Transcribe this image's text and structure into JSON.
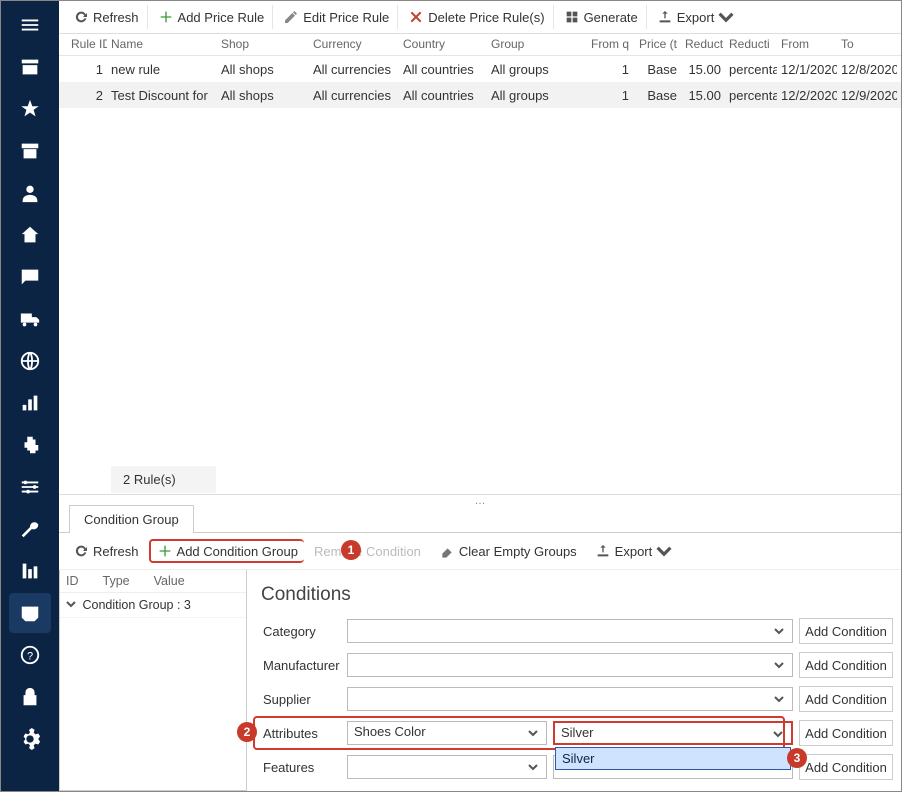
{
  "sidebar": {
    "items": [
      {
        "name": "menu-icon"
      },
      {
        "name": "store-icon"
      },
      {
        "name": "star-icon"
      },
      {
        "name": "archive-icon"
      },
      {
        "name": "person-icon"
      },
      {
        "name": "home-icon"
      },
      {
        "name": "chat-icon"
      },
      {
        "name": "truck-icon"
      },
      {
        "name": "globe-icon"
      },
      {
        "name": "bar-chart-icon"
      },
      {
        "name": "plugin-icon"
      },
      {
        "name": "sliders-icon"
      },
      {
        "name": "wrench-icon"
      },
      {
        "name": "stats-icon"
      },
      {
        "name": "inbox-icon",
        "active": true
      },
      {
        "name": "help-icon"
      },
      {
        "name": "lock-icon"
      },
      {
        "name": "gear-icon"
      }
    ]
  },
  "toolbar1": {
    "refresh": "Refresh",
    "add": "Add Price Rule",
    "edit": "Edit Price Rule",
    "del": "Delete Price Rule(s)",
    "gen": "Generate",
    "export": "Export"
  },
  "grid": {
    "headers": [
      "Rule ID",
      "Name",
      "Shop",
      "Currency",
      "Country",
      "Group",
      "From q",
      "Price (t",
      "Reduct",
      "Reducti",
      "From",
      "To"
    ],
    "rows": [
      {
        "id": "1",
        "name": "new rule",
        "shop": "All shops",
        "cur": "All currencies",
        "ctry": "All countries",
        "grp": "All groups",
        "qty": "1",
        "price": "Base",
        "red": "15.00",
        "redt": "percenta",
        "from": "12/1/2020",
        "to": "12/8/2020"
      },
      {
        "id": "2",
        "name": "Test Discount for",
        "shop": "All shops",
        "cur": "All currencies",
        "ctry": "All countries",
        "grp": "All groups",
        "qty": "1",
        "price": "Base",
        "red": "15.00",
        "redt": "percenta",
        "from": "12/2/2020",
        "to": "12/9/2020"
      }
    ],
    "footer": "2 Rule(s)"
  },
  "tabs": {
    "conditionGroup": "Condition Group"
  },
  "toolbar2": {
    "refresh": "Refresh",
    "addGroup": "Add Condition Group",
    "remove": "Remove Condition",
    "clear": "Clear Empty Groups",
    "export": "Export"
  },
  "callouts": {
    "one": "1",
    "two": "2",
    "three": "3"
  },
  "tree": {
    "headers": [
      "ID",
      "Type",
      "Value"
    ],
    "group": "Condition Group : 3"
  },
  "conditions": {
    "title": "Conditions",
    "rows": [
      {
        "label": "Category",
        "value": "",
        "addLabel": "Add Condition"
      },
      {
        "label": "Manufacturer",
        "value": "",
        "addLabel": "Add Condition"
      },
      {
        "label": "Supplier",
        "value": "",
        "addLabel": "Add Condition"
      },
      {
        "label": "Attributes",
        "value": "Shoes Color",
        "value2": "Silver",
        "addLabel": "Add Condition",
        "highlighted": true,
        "dropdownOption": "Silver"
      },
      {
        "label": "Features",
        "value": "",
        "addLabel": "Add Condition"
      }
    ]
  }
}
